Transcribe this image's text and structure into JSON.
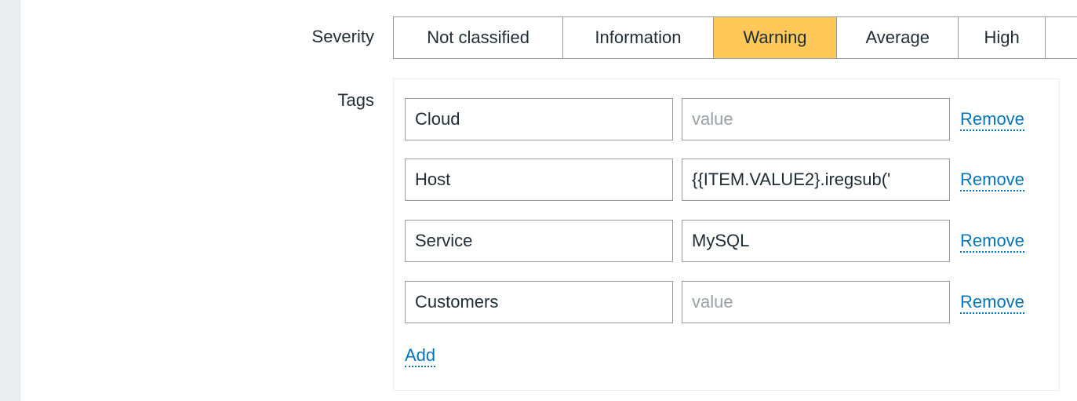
{
  "form": {
    "severity_label": "Severity",
    "tags_label": "Tags"
  },
  "severity": {
    "selected": "Warning",
    "options": [
      {
        "label": "Not classified"
      },
      {
        "label": "Information"
      },
      {
        "label": "Warning"
      },
      {
        "label": "Average"
      },
      {
        "label": "High"
      }
    ]
  },
  "tags": {
    "rows": [
      {
        "name": "Cloud",
        "value": "",
        "value_placeholder": "value",
        "remove_label": "Remove"
      },
      {
        "name": "Host",
        "value": "{{ITEM.VALUE2}.iregsub('",
        "value_placeholder": "value",
        "remove_label": "Remove"
      },
      {
        "name": "Service",
        "value": "MySQL",
        "value_placeholder": "value",
        "remove_label": "Remove"
      },
      {
        "name": "Customers",
        "value": "",
        "value_placeholder": "value",
        "remove_label": "Remove"
      }
    ],
    "add_label": "Add"
  },
  "colors": {
    "selected_severity_bg": "#ffc859",
    "link": "#0275b8",
    "border": "#989b9d",
    "sidebar_bg": "#ebeef0"
  }
}
